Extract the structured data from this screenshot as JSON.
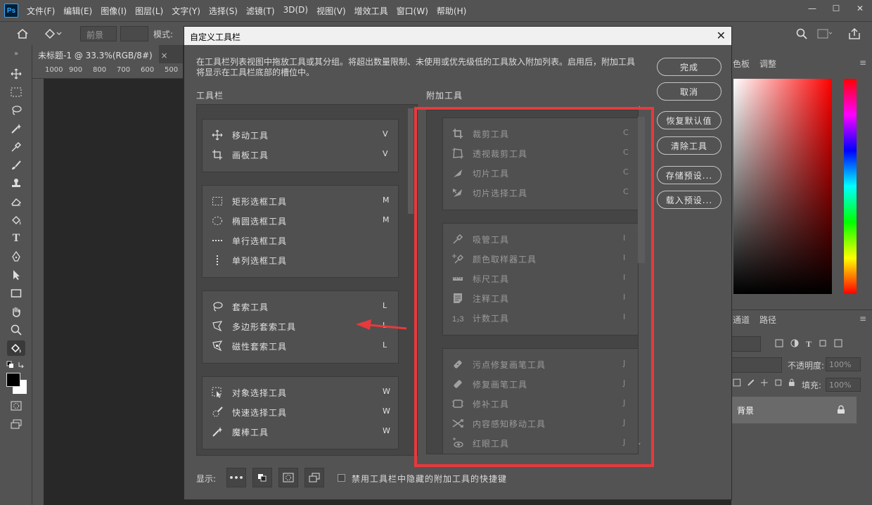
{
  "app": {
    "logo": "Ps"
  },
  "menubar": {
    "items": [
      "文件(F)",
      "编辑(E)",
      "图像(I)",
      "图层(L)",
      "文字(Y)",
      "选择(S)",
      "滤镜(T)",
      "3D(D)",
      "视图(V)",
      "增效工具",
      "窗口(W)",
      "帮助(H)"
    ],
    "window_controls": [
      "—",
      "☐",
      "✕"
    ]
  },
  "options_bar": {
    "fg_label": "前景",
    "mode_label": "模式:"
  },
  "document": {
    "tab_title": "未标题-1 @ 33.3%(RGB/8#)",
    "tab_close": "×",
    "ruler_ticks": [
      "1000",
      "900",
      "800",
      "700",
      "600",
      "500"
    ]
  },
  "right_panels": {
    "color_tab": "色板",
    "adjust_tab": "调整",
    "channels_tab": "通道",
    "paths_tab": "路径",
    "opacity_label": "不透明度:",
    "opacity_value": "100%",
    "fill_label": "填充:",
    "fill_value": "100%",
    "layer_name": "背景"
  },
  "dialog": {
    "title": "自定义工具栏",
    "close": "✕",
    "description": "在工具栏列表视图中拖放工具或其分组。将超出数量限制、未使用或优先级低的工具放入附加列表。启用后，附加工具将显示在工具栏底部的槽位中。",
    "toolbar_heading": "工具栏",
    "extra_heading": "附加工具",
    "buttons": {
      "done": "完成",
      "cancel": "取消",
      "restore": "恢复默认值",
      "clear": "清除工具",
      "save": "存储预设...",
      "load": "载入预设..."
    },
    "footer": {
      "show_label": "显示:",
      "dots": "•••",
      "checkbox_label": "禁用工具栏中隐藏的附加工具的快捷键",
      "checkbox_checked": false
    },
    "toolbar_groups": [
      {
        "tools": [
          {
            "icon": "move-icon",
            "label": "移动工具",
            "key": "V"
          },
          {
            "icon": "artboard-icon",
            "label": "画板工具",
            "key": "V"
          }
        ]
      },
      {
        "tools": [
          {
            "icon": "rect-marquee-icon",
            "label": "矩形选框工具",
            "key": "M"
          },
          {
            "icon": "ellipse-marquee-icon",
            "label": "椭圆选框工具",
            "key": "M"
          },
          {
            "icon": "row-marquee-icon",
            "label": "单行选框工具",
            "key": ""
          },
          {
            "icon": "col-marquee-icon",
            "label": "单列选框工具",
            "key": ""
          }
        ]
      },
      {
        "tools": [
          {
            "icon": "lasso-icon",
            "label": "套索工具",
            "key": "L"
          },
          {
            "icon": "poly-lasso-icon",
            "label": "多边形套索工具",
            "key": "L"
          },
          {
            "icon": "magnetic-lasso-icon",
            "label": "磁性套索工具",
            "key": "L"
          }
        ]
      },
      {
        "tools": [
          {
            "icon": "object-select-icon",
            "label": "对象选择工具",
            "key": "W"
          },
          {
            "icon": "quick-select-icon",
            "label": "快速选择工具",
            "key": "W"
          },
          {
            "icon": "magic-wand-icon",
            "label": "魔棒工具",
            "key": "W"
          }
        ]
      }
    ],
    "extra_groups": [
      {
        "tools": [
          {
            "icon": "crop-icon",
            "label": "裁剪工具",
            "key": "C"
          },
          {
            "icon": "perspective-crop-icon",
            "label": "透视裁剪工具",
            "key": "C"
          },
          {
            "icon": "slice-icon",
            "label": "切片工具",
            "key": "C"
          },
          {
            "icon": "slice-select-icon",
            "label": "切片选择工具",
            "key": "C"
          }
        ]
      },
      {
        "tools": [
          {
            "icon": "eyedropper-icon",
            "label": "吸管工具",
            "key": "I"
          },
          {
            "icon": "color-sampler-icon",
            "label": "颜色取样器工具",
            "key": "I"
          },
          {
            "icon": "ruler-icon",
            "label": "标尺工具",
            "key": "I"
          },
          {
            "icon": "note-icon",
            "label": "注释工具",
            "key": "I"
          },
          {
            "icon": "count-icon",
            "label": "计数工具",
            "key": "I"
          }
        ]
      },
      {
        "tools": [
          {
            "icon": "spot-heal-icon",
            "label": "污点修复画笔工具",
            "key": "J"
          },
          {
            "icon": "heal-brush-icon",
            "label": "修复画笔工具",
            "key": "J"
          },
          {
            "icon": "patch-icon",
            "label": "修补工具",
            "key": "J"
          },
          {
            "icon": "content-move-icon",
            "label": "内容感知移动工具",
            "key": "J"
          },
          {
            "icon": "red-eye-icon",
            "label": "红眼工具",
            "key": "J"
          }
        ]
      }
    ]
  },
  "colors": {
    "highlight": "#e8393c",
    "arrow": "#e8393c",
    "dialog_bg": "#535353",
    "ps_blue": "#31a8ff"
  }
}
